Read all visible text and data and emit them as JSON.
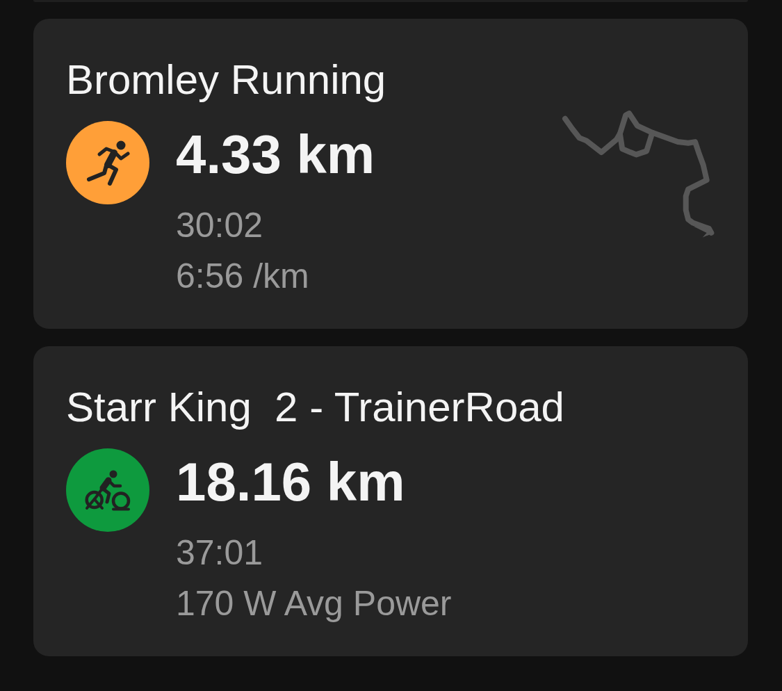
{
  "activities": [
    {
      "title": "Bromley Running",
      "kind": "run",
      "color": "#ff9f38",
      "distance": "4.33 km",
      "stats": [
        "30:02",
        "6:56 /km"
      ],
      "route_map": true
    },
    {
      "title": "Starr King  2 - TrainerRoad",
      "kind": "ride",
      "color": "#0e9a3e",
      "distance": "18.16 km",
      "stats": [
        "37:01",
        "170 W Avg Power"
      ],
      "route_map": false
    }
  ]
}
